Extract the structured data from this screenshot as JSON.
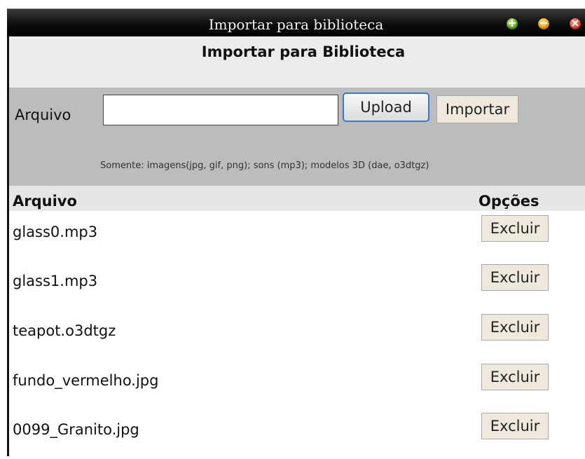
{
  "window": {
    "title": "Importar para biblioteca",
    "buttons": {
      "maximize_icon": "+",
      "minimize_icon": "−",
      "close_icon": "×"
    }
  },
  "page_title": "Importar para Biblioteca",
  "upload": {
    "file_label": "Arquivo",
    "file_value": "",
    "upload_button": "Upload",
    "import_button": "Importar",
    "hint": "Somente: imagens(jpg, gif, png); sons (mp3); modelos 3D (dae, o3dtgz)"
  },
  "table": {
    "headers": {
      "file": "Arquivo",
      "options": "Opções"
    },
    "rows": [
      {
        "name": "glass0.mp3",
        "action": "Excluir"
      },
      {
        "name": "glass1.mp3",
        "action": "Excluir"
      },
      {
        "name": "teapot.o3dtgz",
        "action": "Excluir"
      },
      {
        "name": "fundo_vermelho.jpg",
        "action": "Excluir"
      },
      {
        "name": "0099_Granito.jpg",
        "action": "Excluir"
      }
    ]
  }
}
